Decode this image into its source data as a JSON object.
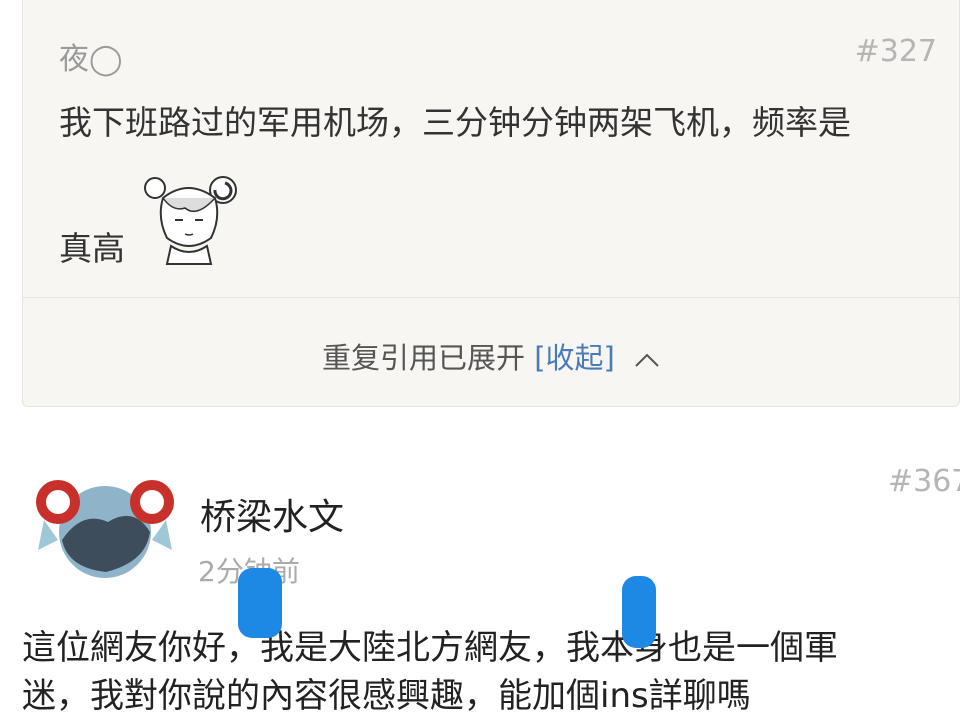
{
  "quote": {
    "username": "夜◯",
    "floor": "#327",
    "text_line1": "我下班路过的军用机场，三分钟分钟两架飞机，频率是",
    "text_line2": "真高",
    "expand_text": "重复引用已展开",
    "collapse_label": "[收起]"
  },
  "reply": {
    "username": "桥梁水文",
    "time": "2分钟前",
    "floor": "#367",
    "text_line1": "這位網友你好，我是大陸北方網友，我本身也是一個軍",
    "text_line2": "迷，我對你說的內容很感興趣，能加個ins詳聊嗎"
  },
  "colors": {
    "card_bg": "#f7f6f2",
    "link": "#4a7bb8",
    "redaction": "#1e88e5"
  },
  "icons": [
    "sticker-icon",
    "chevron-up-icon",
    "avatar-icon"
  ]
}
